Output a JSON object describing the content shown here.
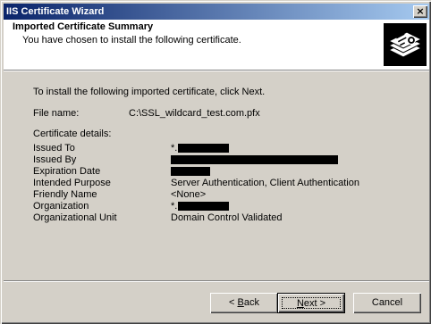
{
  "window": {
    "title": "IIS Certificate Wizard",
    "close_label": "×"
  },
  "header": {
    "title": "Imported Certificate Summary",
    "subtitle": "You have chosen to install the following certificate.",
    "icon": "certificate-icon"
  },
  "content": {
    "instruction": "To install the following imported certificate, click Next.",
    "file_name_label": "File name:",
    "file_name_value": "C:\\SSL_wildcard_test.com.pfx",
    "details_label": "Certificate details:",
    "details": [
      {
        "label": "Issued To",
        "value": "*."
      },
      {
        "label": "Issued By",
        "value": ""
      },
      {
        "label": "Expiration Date",
        "value": ""
      },
      {
        "label": "Intended Purpose",
        "value": "Server Authentication, Client Authentication"
      },
      {
        "label": "Friendly Name",
        "value": "<None>"
      },
      {
        "label": "Organization",
        "value": "*."
      },
      {
        "label": "Organizational Unit",
        "value": "Domain Control Validated"
      }
    ]
  },
  "buttons": {
    "back_prefix": "< ",
    "back_mnemonic": "B",
    "back_rest": "ack",
    "next_mnemonic": "N",
    "next_rest": "ext >",
    "cancel": "Cancel"
  }
}
